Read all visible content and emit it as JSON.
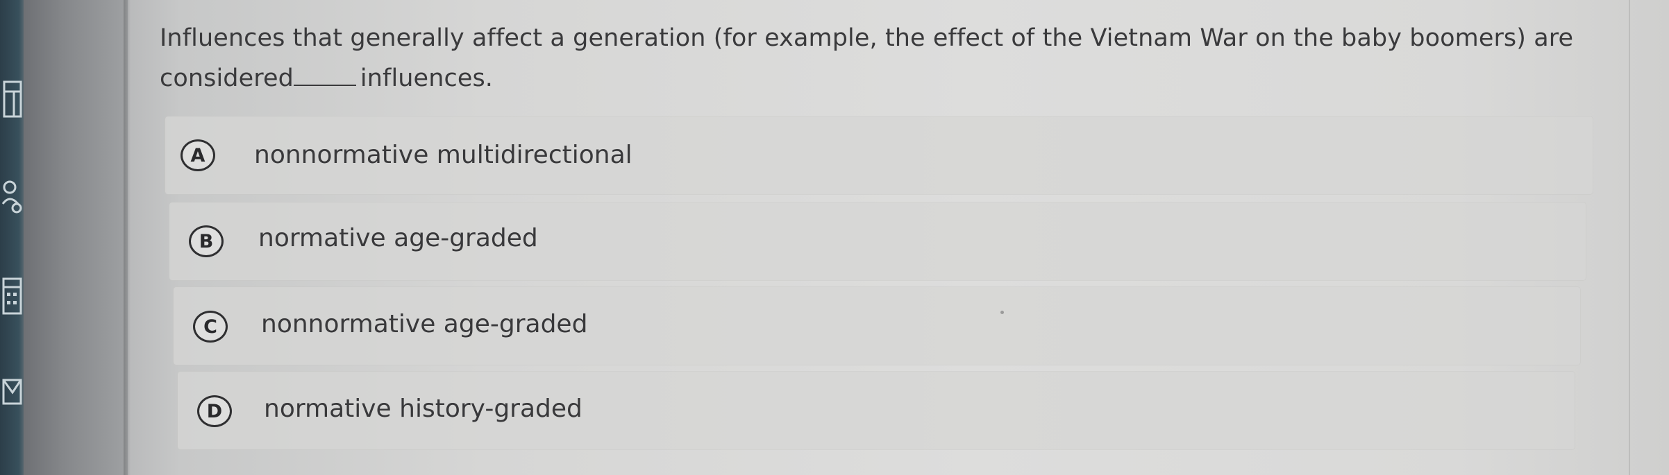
{
  "question": {
    "text_before_blank": "Influences that generally affect a generation (for example, the effect of the Vietnam War on the baby boomers) are considered",
    "text_after_blank": "influences."
  },
  "options": [
    {
      "letter": "A",
      "label": "nonnormative multidirectional"
    },
    {
      "letter": "B",
      "label": "normative age-graded"
    },
    {
      "letter": "C",
      "label": "nonnormative age-graded"
    },
    {
      "letter": "D",
      "label": "normative history-graded"
    }
  ],
  "sidebar": {
    "icons": [
      "notebook-icon",
      "people-icon",
      "calendar-icon",
      "mail-icon"
    ]
  },
  "colors": {
    "text": "#3a3a3c",
    "option_background": "#d6d6d4",
    "badge_border": "#2f2f31",
    "sidebar": "#38505c"
  }
}
